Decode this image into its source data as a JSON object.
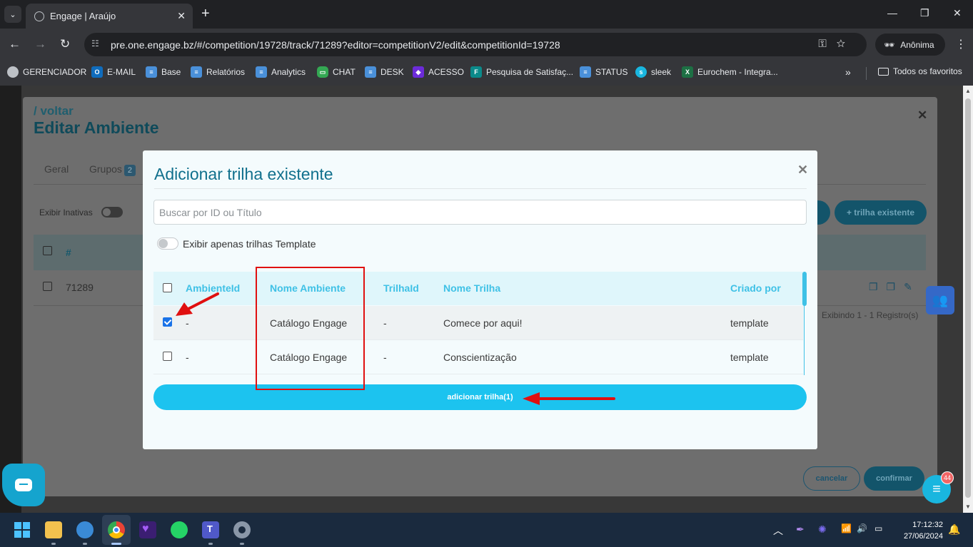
{
  "browser": {
    "tab_title": "Engage | Araújo",
    "url": "pre.one.engage.bz/#/competition/19728/track/71289?editor=competitionV2/edit&competitionId=19728",
    "profile_label": "Anônima",
    "bookmarks": [
      {
        "label": "GERENCIADOR",
        "icon": "gear-globe-icon",
        "color": "#bdc1c6"
      },
      {
        "label": "E-MAIL",
        "icon": "outlook-icon",
        "color": "#0f6cbd"
      },
      {
        "label": "Base",
        "icon": "zendesk-icon",
        "color": "#4a90d9"
      },
      {
        "label": "Relatórios",
        "icon": "zendesk-icon",
        "color": "#4a90d9"
      },
      {
        "label": "Analytics",
        "icon": "zendesk-icon",
        "color": "#4a90d9"
      },
      {
        "label": "CHAT",
        "icon": "chat-icon",
        "color": "#34a853"
      },
      {
        "label": "DESK",
        "icon": "zendesk-icon",
        "color": "#4a90d9"
      },
      {
        "label": "ACESSO",
        "icon": "acesso-icon",
        "color": "#6c2bd9"
      },
      {
        "label": "Pesquisa de Satisfaç...",
        "icon": "forms-icon",
        "color": "#0b8a8a"
      },
      {
        "label": "STATUS",
        "icon": "zendesk-icon",
        "color": "#4a90d9"
      },
      {
        "label": "sleek",
        "icon": "sleek-icon",
        "color": "#19b6df"
      },
      {
        "label": "Eurochem - Integra...",
        "icon": "excel-icon",
        "color": "#1d7044"
      }
    ],
    "all_bookmarks_label": "Todos os favoritos"
  },
  "background_page": {
    "back_link": "/ voltar",
    "title": "Editar Ambiente",
    "tabs": [
      {
        "label": "Geral"
      },
      {
        "label": "Grupos",
        "badge": "2"
      }
    ],
    "toggle_label": "Exibir Inativas",
    "add_existing_button": "+ trilha existente",
    "table_header_hash": "#",
    "row_id": "71289",
    "paging_text": "Exibindo 1 - 1 Registro(s)",
    "cancel_button": "cancelar",
    "confirm_button": "confirmar",
    "support_badge_count": "44"
  },
  "modal": {
    "title": "Adicionar trilha existente",
    "search_placeholder": "Buscar por ID ou Título",
    "template_toggle_label": "Exibir apenas trilhas Template",
    "columns": [
      "AmbienteId",
      "Nome Ambiente",
      "TrilhaId",
      "Nome Trilha",
      "Criado por"
    ],
    "rows": [
      {
        "checked": true,
        "ambiente_id": "-",
        "nome_ambiente": "Catálogo Engage",
        "trilha_id": "-",
        "nome_trilha": "Comece por aqui!",
        "criado_por": "template"
      },
      {
        "checked": false,
        "ambiente_id": "-",
        "nome_ambiente": "Catálogo Engage",
        "trilha_id": "-",
        "nome_trilha": "Conscientização",
        "criado_por": "template"
      }
    ],
    "add_button": "adicionar trilha(1)"
  },
  "taskbar": {
    "time": "17:12:32",
    "date": "27/06/2024"
  },
  "colors": {
    "accent": "#1cc3ef",
    "title": "#11708d",
    "annotation": "#e01010"
  }
}
